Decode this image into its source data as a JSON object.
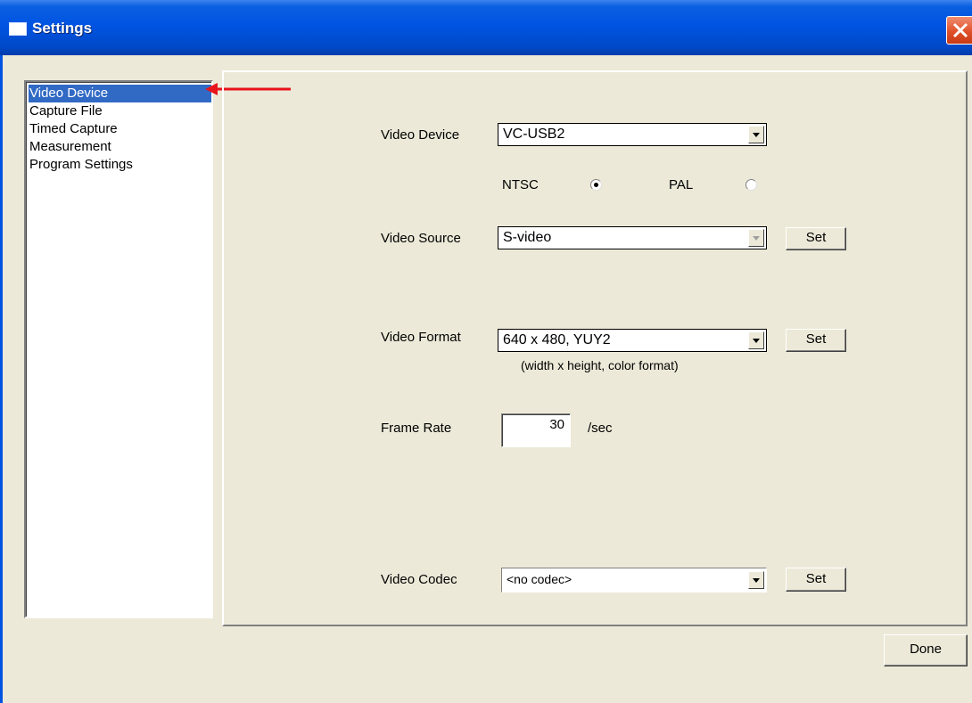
{
  "window": {
    "title": "Settings",
    "close_glyph": "✕"
  },
  "nav": {
    "items": [
      {
        "label": "Video Device",
        "selected": true
      },
      {
        "label": "Capture File",
        "selected": false
      },
      {
        "label": "Timed Capture",
        "selected": false
      },
      {
        "label": "Measurement",
        "selected": false
      },
      {
        "label": "Program Settings",
        "selected": false
      }
    ],
    "annotation_arrow_color": "#e8141b"
  },
  "video_device": {
    "label": "Video Device",
    "value": "VC-USB2",
    "standards": [
      {
        "label": "NTSC",
        "checked": true
      },
      {
        "label": "PAL",
        "checked": false
      }
    ]
  },
  "video_source": {
    "label": "Video Source",
    "value": "S-video",
    "enabled": false,
    "set_label": "Set"
  },
  "video_format": {
    "label": "Video Format",
    "value": "640 x 480, YUY2",
    "hint": "(width x height, color format)",
    "set_label": "Set"
  },
  "frame_rate": {
    "label": "Frame Rate",
    "value": "30",
    "unit": "/sec"
  },
  "video_codec": {
    "label": "Video Codec",
    "value": "<no codec>",
    "set_label": "Set"
  },
  "footer": {
    "done_label": "Done"
  },
  "colors": {
    "titlebar": "#0054e3",
    "selection": "#316ac5",
    "face": "#ece9d8",
    "close": "#e0512a"
  }
}
